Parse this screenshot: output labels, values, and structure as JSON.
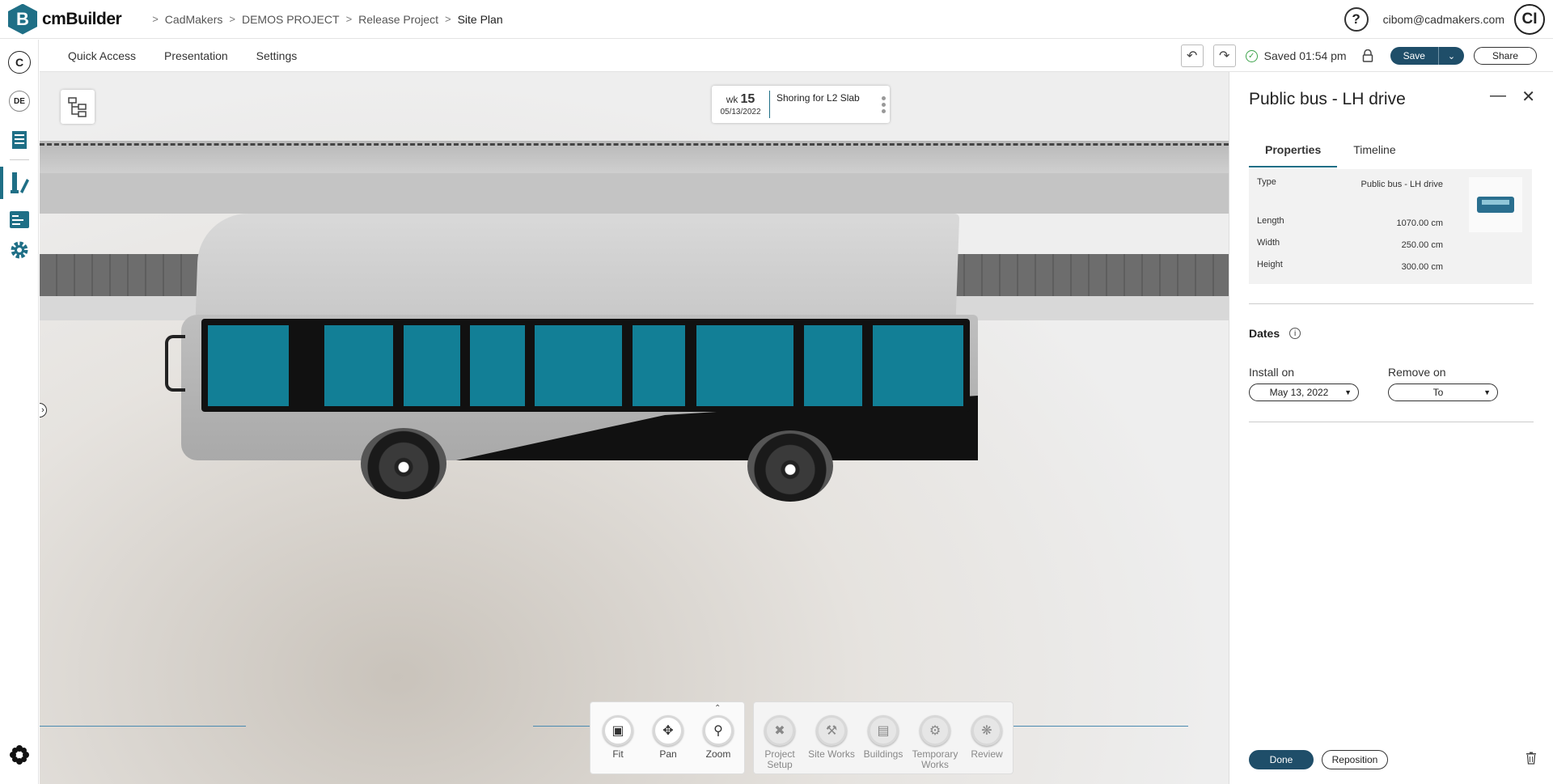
{
  "app": {
    "name": "cmBuilder",
    "logo_letter": "B"
  },
  "breadcrumb": [
    "CadMakers",
    "DEMOS PROJECT",
    "Release Project",
    "Site Plan"
  ],
  "header": {
    "help_label": "?",
    "user_email": "cibom@cadmakers.com",
    "avatar_initials": "CI"
  },
  "sidebar": {
    "company_initial": "C",
    "lang": "DE"
  },
  "toolbar": {
    "menus": [
      "Quick Access",
      "Presentation",
      "Settings"
    ],
    "saved_text": "Saved 01:54 pm",
    "save_label": "Save",
    "share_label": "Share"
  },
  "week_card": {
    "wk_label": "wk",
    "week": "15",
    "date": "05/13/2022",
    "task": "Shoring for L2 Slab"
  },
  "nav_tools": [
    {
      "label": "Fit",
      "icon": "fit-icon"
    },
    {
      "label": "Pan",
      "icon": "pan-icon"
    },
    {
      "label": "Zoom",
      "icon": "zoom-icon"
    }
  ],
  "build_tools": [
    {
      "label": "Project Setup",
      "icon": "project-setup-icon"
    },
    {
      "label": "Site Works",
      "icon": "site-works-icon"
    },
    {
      "label": "Buildings",
      "icon": "buildings-icon"
    },
    {
      "label": "Temporary Works",
      "icon": "temporary-works-icon"
    },
    {
      "label": "Review",
      "icon": "review-icon"
    }
  ],
  "panel": {
    "title": "Public bus - LH drive",
    "tabs": [
      "Properties",
      "Timeline"
    ],
    "properties": [
      {
        "label": "Type",
        "value": "Public bus - LH drive"
      },
      {
        "label": "Length",
        "value": "1070.00 cm"
      },
      {
        "label": "Width",
        "value": "250.00 cm"
      },
      {
        "label": "Height",
        "value": "300.00 cm"
      }
    ],
    "dates_title": "Dates",
    "install_label": "Install on",
    "install_value": "May 13, 2022",
    "remove_label": "Remove on",
    "remove_value": "To",
    "done_label": "Done",
    "reposition_label": "Reposition"
  },
  "colors": {
    "brand": "#1f6f86",
    "primary_button": "#1f4e69",
    "saved_check": "#3ca34a",
    "bus_window": "#127f96"
  }
}
